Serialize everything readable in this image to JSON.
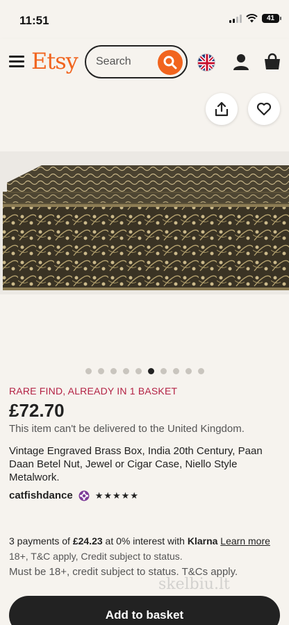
{
  "status_bar": {
    "time": "11:51",
    "battery": "41"
  },
  "header": {
    "logo": "Etsy",
    "search_placeholder": "Search"
  },
  "carousel": {
    "dot_count": 10,
    "active_index": 5
  },
  "product": {
    "badge": "RARE FIND, ALREADY IN 1 BASKET",
    "price": "£72.70",
    "delivery_note": "This item can't be delivered to the United Kingdom.",
    "title": "Vintage Engraved Brass Box, India 20th Century, Paan Daan Betel Nut, Jewel or Cigar Case, Niello Style Metalwork.",
    "shop_name": "catfishdance",
    "rating_stars": "★★★★★"
  },
  "payment": {
    "prefix": "3 payments of ",
    "amount": "£24.23",
    "middle": " at 0% interest with ",
    "provider": "Klarna",
    "link": "Learn more",
    "terms": "18+, T&C apply, Credit subject to status.",
    "must": "Must be 18+, credit subject to status. T&Cs apply."
  },
  "watermark": "skelbiu.lt",
  "actions": {
    "add_to_basket": "Add to basket"
  },
  "colors": {
    "brand": "#f1641e",
    "badge": "#b32144",
    "button": "#222222"
  }
}
